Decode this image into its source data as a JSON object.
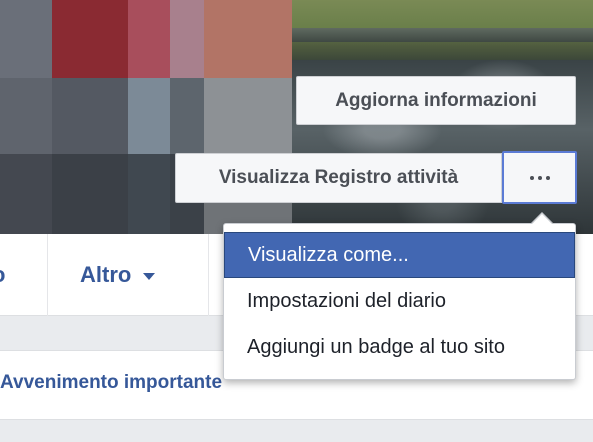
{
  "cover": {
    "update_info_label": "Aggiorna informazioni",
    "activity_log_label": "Visualizza Registro attività",
    "more_icon": "ellipsis-icon"
  },
  "nav": {
    "partial_item_label": "o",
    "more_label": "Altro",
    "more_icon": "caret-down-icon"
  },
  "composer": {
    "life_event_label": "Avvenimento importante"
  },
  "dropdown": {
    "items": [
      {
        "label": "Visualizza come...",
        "active": true
      },
      {
        "label": "Impostazioni del diario",
        "active": false
      },
      {
        "label": "Aggiungi un badge al tuo sito",
        "active": false
      }
    ]
  },
  "colors": {
    "link_blue": "#365899",
    "menu_highlight": "#4267b2",
    "focus_border": "#5b7bd5",
    "page_bg": "#e9ebee"
  }
}
